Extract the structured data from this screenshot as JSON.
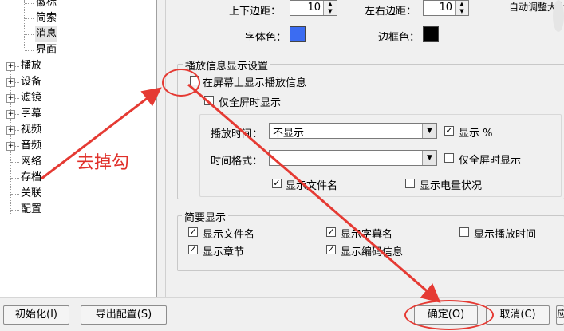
{
  "tree": {
    "items": [
      {
        "label": "徽标",
        "expandable": false
      },
      {
        "label": "简索",
        "expandable": false
      },
      {
        "label": "消息",
        "expandable": false,
        "selected": true
      },
      {
        "label": "界面",
        "expandable": false
      },
      {
        "label": "播放",
        "expandable": true
      },
      {
        "label": "设备",
        "expandable": true
      },
      {
        "label": "滤镜",
        "expandable": true
      },
      {
        "label": "字幕",
        "expandable": true
      },
      {
        "label": "视频",
        "expandable": true
      },
      {
        "label": "音频",
        "expandable": true
      },
      {
        "label": "网络",
        "expandable": false
      },
      {
        "label": "存档",
        "expandable": false
      },
      {
        "label": "关联",
        "expandable": false
      },
      {
        "label": "配置",
        "expandable": false
      }
    ],
    "expand_glyph": "+"
  },
  "top": {
    "tb_margin_label": "上下边距：",
    "tb_margin_value": "10",
    "lr_margin_label": "左右边距：",
    "lr_margin_value": "10",
    "auto_adjust_label": "自动调整大小",
    "font_color_label": "字体色：",
    "font_color": "#3b6cf2",
    "border_color_label": "边框色：",
    "border_color": "#000000"
  },
  "play_info": {
    "group_title": "播放信息显示设置",
    "show_on_screen": {
      "label": "在屏幕上显示播放信息",
      "checked": false
    },
    "fullscreen_only": {
      "label": "仅全屏时显示",
      "checked": false
    },
    "play_time_label": "播放时间：",
    "play_time_value": "不显示",
    "show_percent": {
      "label": "显示 %",
      "checked": true
    },
    "time_format_label": "时间格式：",
    "time_format_value": "",
    "fullscreen_only2": {
      "label": "仅全屏时显示",
      "checked": false
    },
    "show_filename": {
      "label": "显示文件名",
      "checked": true
    },
    "show_battery": {
      "label": "显示电量状况",
      "checked": false
    }
  },
  "brief": {
    "group_title": "简要显示",
    "show_filename": {
      "label": "显示文件名",
      "checked": true
    },
    "show_subtitle_name": {
      "label": "显示字幕名",
      "checked": true
    },
    "show_play_time": {
      "label": "显示播放时间",
      "checked": false
    },
    "show_chapter": {
      "label": "显示章节",
      "checked": true
    },
    "show_codec_info": {
      "label": "显示编码信息",
      "checked": true
    }
  },
  "buttons": {
    "init": "初始化(I)",
    "export": "导出配置(S)",
    "ok": "确定(O)",
    "cancel": "取消(C)",
    "apply": "应"
  },
  "annotation": {
    "note": "去掉勾",
    "color": "#e53a33"
  },
  "glyphs": {
    "check": "✓",
    "arrow_down": "▼",
    "arrow_up": "▲"
  }
}
